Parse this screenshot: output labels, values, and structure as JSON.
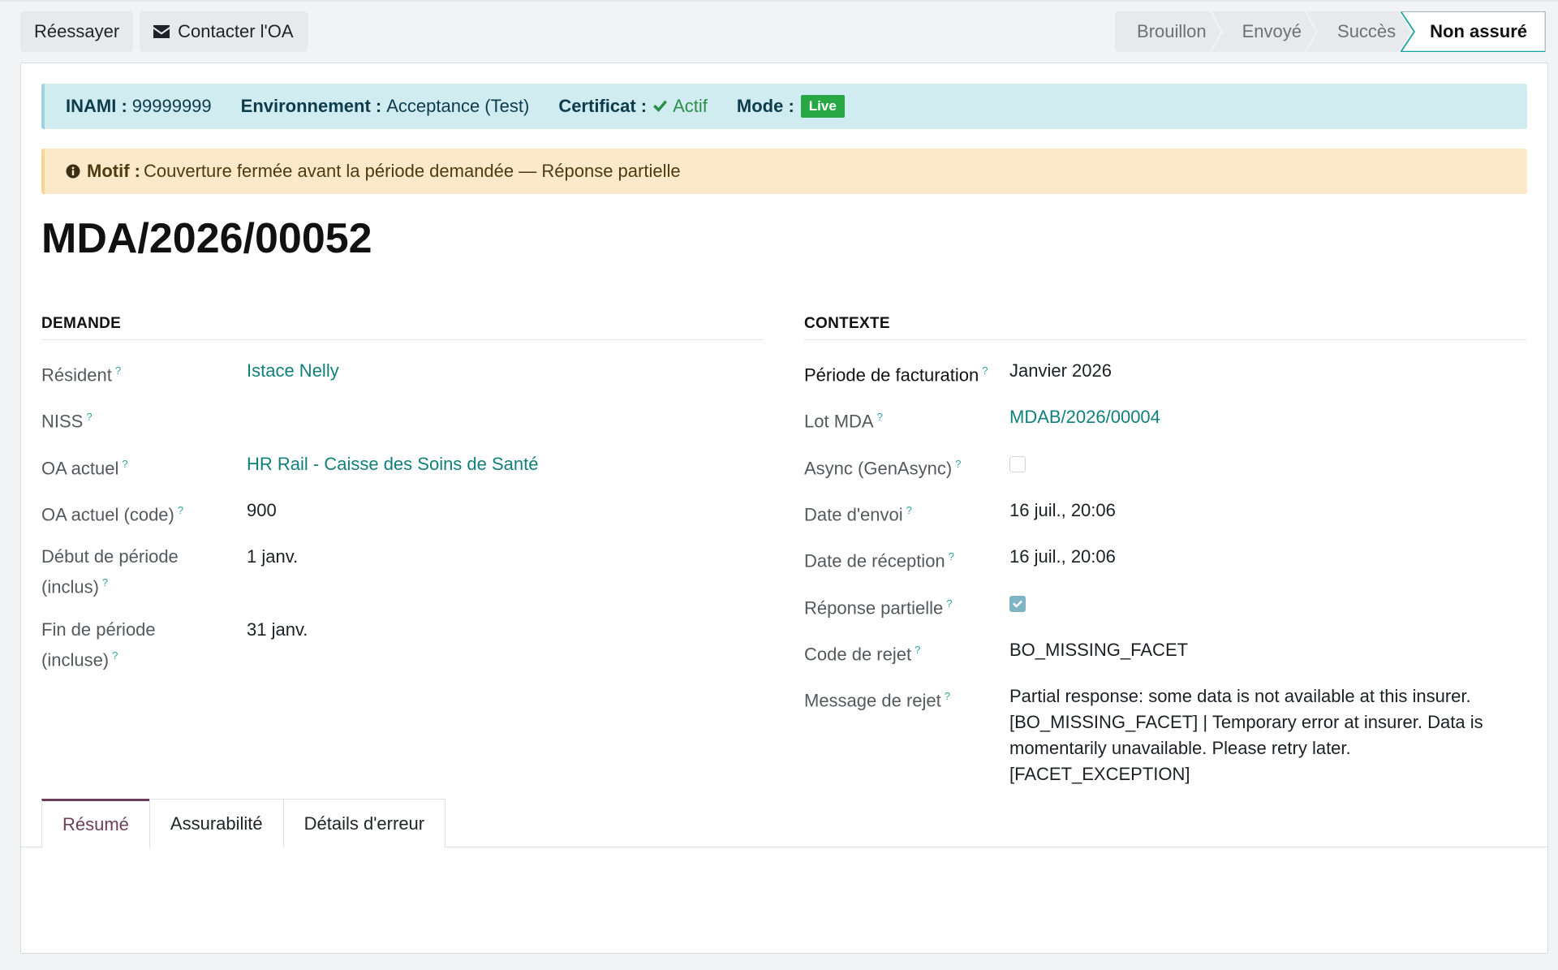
{
  "buttons": {
    "retry": "Réessayer",
    "contact": "Contacter l'OA"
  },
  "status": {
    "stages": [
      "Brouillon",
      "Envoyé",
      "Succès",
      "Non assuré"
    ],
    "current": "Non assuré"
  },
  "banner": {
    "inami_label": "INAMI :",
    "inami_value": "99999999",
    "env_label": "Environnement :",
    "env_value": "Acceptance (Test)",
    "cert_label": "Certificat :",
    "cert_value": "Actif",
    "mode_label": "Mode :",
    "mode_value": "Live"
  },
  "warning": {
    "label": "Motif :",
    "text": "Couverture fermée avant la période demandée — Réponse partielle"
  },
  "record": {
    "title": "MDA/2026/00052"
  },
  "demande": {
    "title": "DEMANDE",
    "fields": {
      "resident": {
        "label": "Résident",
        "value": "Istace Nelly"
      },
      "niss": {
        "label": "NISS",
        "value": ""
      },
      "oa": {
        "label": "OA actuel",
        "value": "HR Rail - Caisse des Soins de Santé"
      },
      "oa_code": {
        "label": "OA actuel (code)",
        "value": "900"
      },
      "start": {
        "label": "Début de période (inclus)",
        "value": "1 janv."
      },
      "end": {
        "label": "Fin de période (incluse)",
        "value": "31 janv."
      }
    }
  },
  "contexte": {
    "title": "CONTEXTE",
    "fields": {
      "period": {
        "label": "Période de facturation",
        "value": "Janvier 2026"
      },
      "lot": {
        "label": "Lot MDA",
        "value": "MDAB/2026/00004"
      },
      "async": {
        "label": "Async (GenAsync)",
        "checked": false
      },
      "sent": {
        "label": "Date d'envoi",
        "value": "16 juil., 20:06"
      },
      "received": {
        "label": "Date de réception",
        "value": "16 juil., 20:06"
      },
      "partial": {
        "label": "Réponse partielle",
        "checked": true
      },
      "reject_code": {
        "label": "Code de rejet",
        "value": "BO_MISSING_FACET"
      },
      "reject_msg": {
        "label": "Message de rejet",
        "value": "Partial response: some data is not available at this insurer. [BO_MISSING_FACET] | Temporary error at insurer. Data is momentarily unavailable. Please retry later. [FACET_EXCEPTION]"
      }
    }
  },
  "tabs": [
    "Résumé",
    "Assurabilité",
    "Détails d'erreur"
  ],
  "help_mark": "?",
  "colors": {
    "link": "#11807c",
    "info_bg": "#d1ecf1",
    "warn_bg": "#fbe9c9",
    "live_badge": "#28a745",
    "active_tab": "#6b3f5b"
  }
}
